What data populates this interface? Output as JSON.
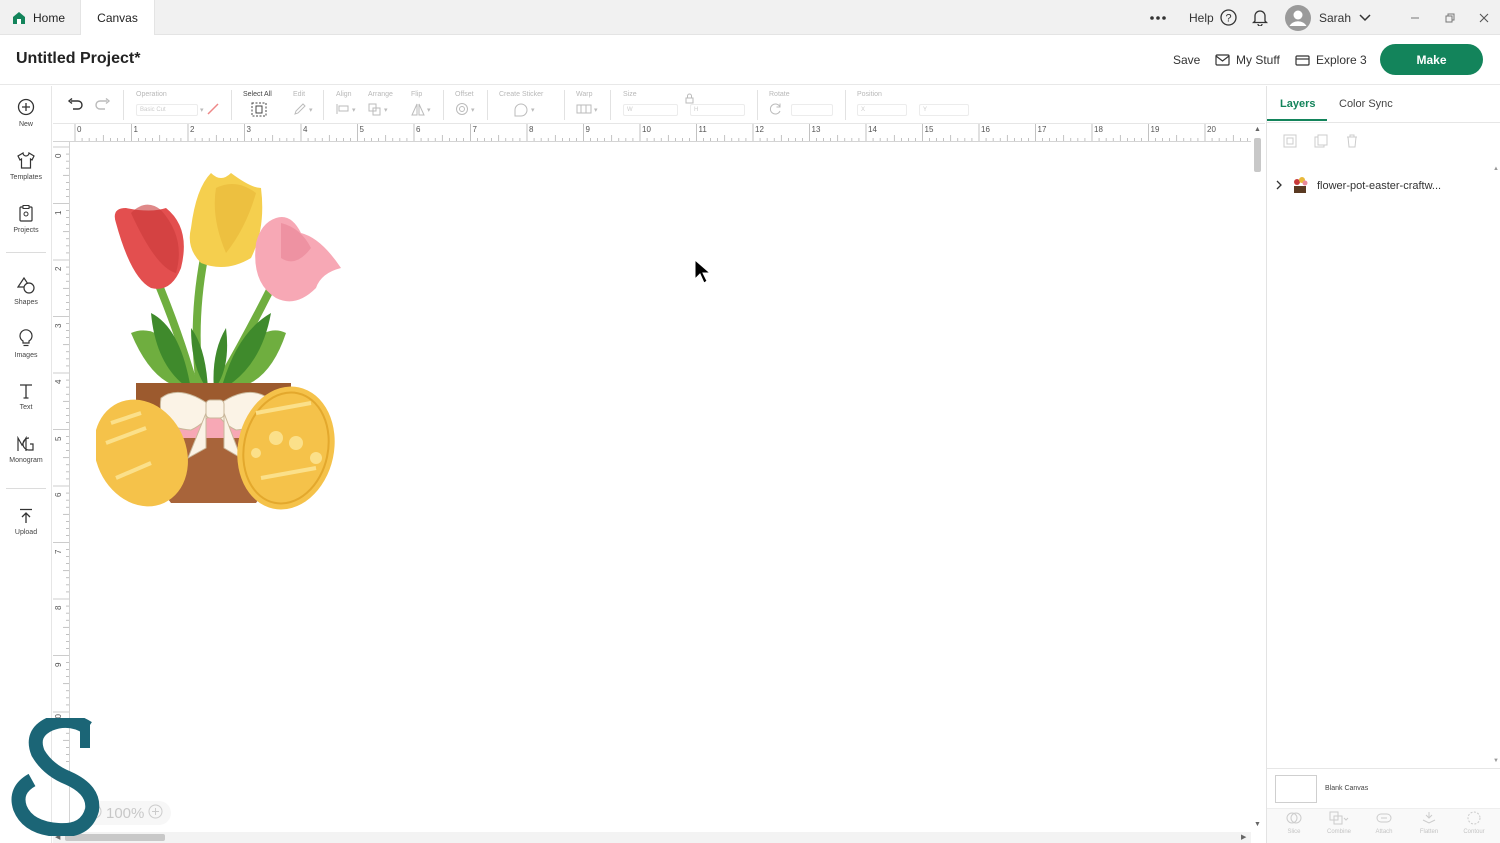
{
  "tabs": {
    "home": "Home",
    "canvas": "Canvas"
  },
  "topbar": {
    "help": "Help",
    "user": "Sarah"
  },
  "header": {
    "project_title": "Untitled Project*",
    "save": "Save",
    "my_stuff": "My Stuff",
    "machine": "Explore 3",
    "make": "Make"
  },
  "toolbar": {
    "operation_label": "Operation",
    "operation_value": "Basic Cut",
    "select_all": "Select All",
    "edit": "Edit",
    "align": "Align",
    "arrange": "Arrange",
    "flip": "Flip",
    "offset": "Offset",
    "create_sticker": "Create Sticker",
    "warp": "Warp",
    "size": "Size",
    "size_w": "W",
    "size_h": "H",
    "rotate": "Rotate",
    "position": "Position",
    "pos_x": "X",
    "pos_y": "Y"
  },
  "sidebar": {
    "items": [
      {
        "label": "New",
        "icon": "plus-circle-icon"
      },
      {
        "label": "Templates",
        "icon": "shirt-icon"
      },
      {
        "label": "Projects",
        "icon": "clipboard-icon"
      },
      {
        "label": "Shapes",
        "icon": "shapes-icon"
      },
      {
        "label": "Images",
        "icon": "lightbulb-icon"
      },
      {
        "label": "Text",
        "icon": "text-icon"
      },
      {
        "label": "Monogram",
        "icon": "monogram-icon"
      },
      {
        "label": "Upload",
        "icon": "upload-icon"
      }
    ]
  },
  "ruler": {
    "h": [
      "0",
      "1",
      "2",
      "3",
      "4",
      "5",
      "6",
      "7",
      "8",
      "9",
      "10",
      "11",
      "12",
      "13",
      "14",
      "15",
      "16",
      "17",
      "18",
      "19",
      "20"
    ],
    "v": [
      "0",
      "1",
      "2",
      "3",
      "4",
      "5",
      "6",
      "7",
      "8",
      "9",
      "10"
    ]
  },
  "zoom": "100%",
  "right_panel": {
    "tab_layers": "Layers",
    "tab_color_sync": "Color Sync",
    "layer_name": "flower-pot-easter-craftw...",
    "blank_canvas": "Blank Canvas",
    "tools": [
      "Slice",
      "Combine",
      "Attach",
      "Flatten",
      "Contour"
    ]
  },
  "colors": {
    "accent": "#13845b",
    "watermark": "#1b6576"
  }
}
